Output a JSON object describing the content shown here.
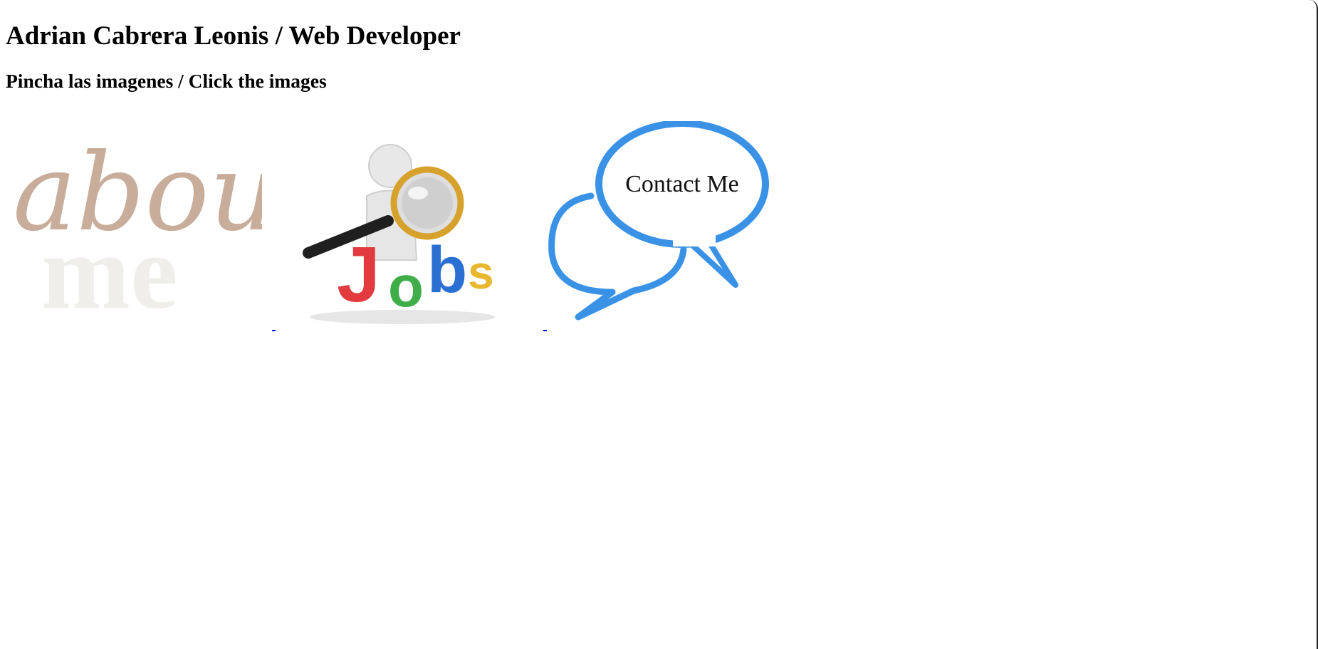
{
  "header": {
    "title": "Adrian Cabrera Leonis / Web Developer",
    "subtitle": "Pincha las imagenes / Click the images"
  },
  "links": [
    {
      "name": "about-me-link",
      "script_word": "about",
      "block_word": "me",
      "colors": {
        "script": "#c8ad9b",
        "block": "#efeeea"
      }
    },
    {
      "name": "jobs-link",
      "letters": [
        "J",
        "o",
        "b",
        "s"
      ],
      "colors": {
        "J": "#e23a3e",
        "o": "#3fae49",
        "b": "#2a6fd2",
        "s": "#e8b730",
        "lens_rim": "#d7a22b",
        "figure": "#e8e8e8"
      }
    },
    {
      "name": "contact-me-link",
      "label": "Contact Me",
      "colors": {
        "bubble": "#3a92e6",
        "text": "#111111"
      }
    }
  ],
  "colors": {
    "link": "#0000ee",
    "text": "#000000",
    "background": "#ffffff"
  }
}
